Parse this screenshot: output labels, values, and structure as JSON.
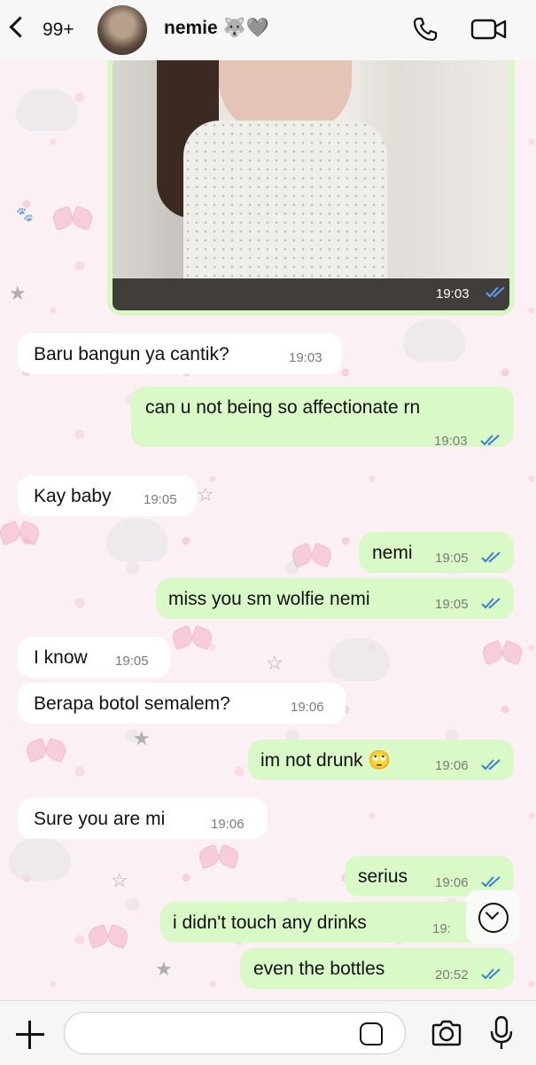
{
  "header": {
    "back_count": "99+",
    "contact_name": "nemie 🐺🩶"
  },
  "photo_message": {
    "time": "19:03"
  },
  "messages": [
    {
      "text": "Baru bangun ya cantik?",
      "time": "19:03",
      "direction": "in"
    },
    {
      "text": "can u not being so affectionate rn",
      "time": "19:03",
      "direction": "out"
    },
    {
      "text": "Kay baby",
      "time": "19:05",
      "direction": "in"
    },
    {
      "text": "nemi",
      "time": "19:05",
      "direction": "out"
    },
    {
      "text": "miss you sm wolfie nemi",
      "time": "19:05",
      "direction": "out"
    },
    {
      "text": "I know",
      "time": "19:05",
      "direction": "in"
    },
    {
      "text": "Berapa botol semalem?",
      "time": "19:06",
      "direction": "in"
    },
    {
      "text": "im not drunk 🙄",
      "time": "19:06",
      "direction": "out"
    },
    {
      "text": "Sure you are mi",
      "time": "19:06",
      "direction": "in"
    },
    {
      "text": "serius",
      "time": "19:06",
      "direction": "out"
    },
    {
      "text": "i didn't touch any drinks",
      "time": "19:",
      "direction": "out"
    },
    {
      "text": "even the bottles",
      "time": "20:52",
      "direction": "out"
    }
  ],
  "colors": {
    "incoming_bubble": "#ffffff",
    "outgoing_bubble": "#d9f9c7",
    "read_check": "#3b7fd6"
  }
}
